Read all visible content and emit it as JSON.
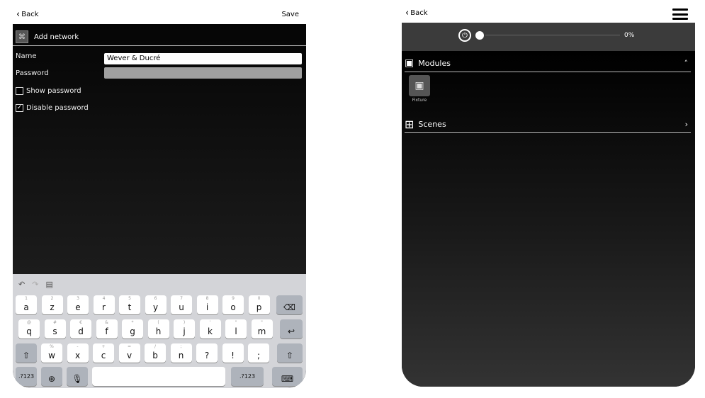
{
  "left": {
    "nav": {
      "back": "Back",
      "save": "Save"
    },
    "header": {
      "title": "Add network"
    },
    "form": {
      "name_label": "Name",
      "name_value": "Wever & Ducré",
      "password_label": "Password",
      "show_password": "Show password",
      "disable_password": "Disable password",
      "show_checked": false,
      "disable_checked": true
    },
    "keyboard": {
      "row1": [
        {
          "k": "a",
          "s": "1"
        },
        {
          "k": "z",
          "s": "2"
        },
        {
          "k": "e",
          "s": "3"
        },
        {
          "k": "r",
          "s": "4"
        },
        {
          "k": "t",
          "s": "5"
        },
        {
          "k": "y",
          "s": "6"
        },
        {
          "k": "u",
          "s": "7"
        },
        {
          "k": "i",
          "s": "8"
        },
        {
          "k": "o",
          "s": "9"
        },
        {
          "k": "p",
          "s": "0"
        }
      ],
      "row2": [
        {
          "k": "q",
          "s": "@"
        },
        {
          "k": "s",
          "s": "#"
        },
        {
          "k": "d",
          "s": "€"
        },
        {
          "k": "f",
          "s": "&"
        },
        {
          "k": "g",
          "s": "*"
        },
        {
          "k": "h",
          "s": "("
        },
        {
          "k": "j",
          "s": ")"
        },
        {
          "k": "k",
          "s": "'"
        },
        {
          "k": "l",
          "s": "\""
        },
        {
          "k": "m",
          "s": "\""
        }
      ],
      "row3": [
        {
          "k": "w",
          "s": "%"
        },
        {
          "k": "x",
          "s": "-"
        },
        {
          "k": "c",
          "s": "+"
        },
        {
          "k": "v",
          "s": "="
        },
        {
          "k": "b",
          "s": "/"
        },
        {
          "k": "n",
          "s": ";"
        },
        {
          "k": "?",
          "s": ""
        },
        {
          "k": "!",
          "s": ""
        },
        {
          "k": ";",
          "s": ""
        }
      ],
      "num_label": ".?123",
      "num_label_right": ".?123"
    }
  },
  "right": {
    "nav": {
      "back": "Back"
    },
    "dimmer": {
      "percent": "0%"
    },
    "modules": {
      "title": "Modules",
      "tile_label": "Fixture"
    },
    "scenes": {
      "title": "Scenes"
    }
  }
}
